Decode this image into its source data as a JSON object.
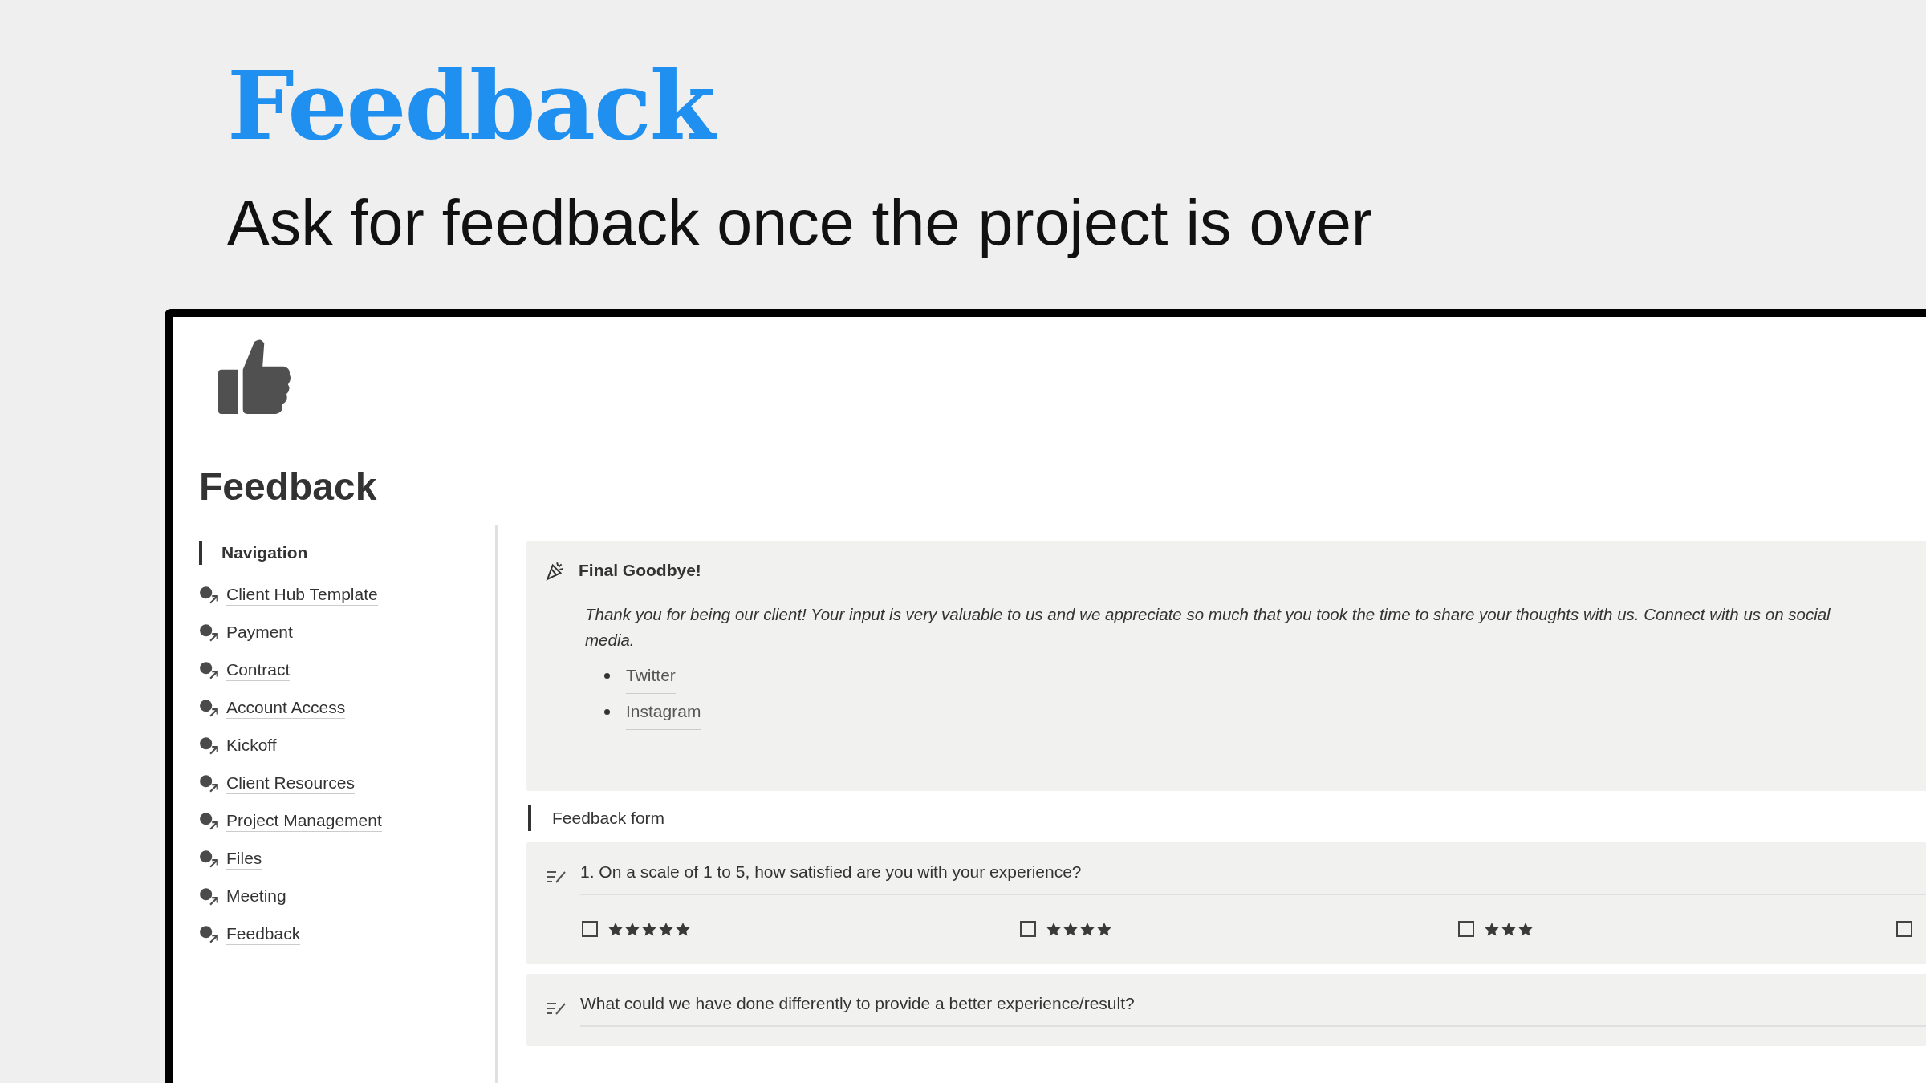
{
  "header": {
    "title": "Feedback",
    "subtitle": "Ask for feedback once the project is over"
  },
  "page": {
    "title": "Feedback"
  },
  "navigation": {
    "heading": "Navigation",
    "items": [
      {
        "label": "Client Hub Template"
      },
      {
        "label": "Payment"
      },
      {
        "label": "Contract"
      },
      {
        "label": "Account Access"
      },
      {
        "label": "Kickoff"
      },
      {
        "label": "Client Resources"
      },
      {
        "label": "Project Management"
      },
      {
        "label": "Files"
      },
      {
        "label": "Meeting"
      },
      {
        "label": "Feedback"
      }
    ]
  },
  "callout": {
    "title": "Final Goodbye!",
    "body": "Thank you for being our client! Your input is very valuable to us and we appreciate so much that you took the time to share your thoughts with us. Connect with us on social media.",
    "links": [
      "Twitter",
      "Instagram"
    ]
  },
  "form": {
    "heading": "Feedback form",
    "questions": [
      {
        "kind": "rating",
        "text": "1. On a scale of 1 to 5, how satisfied are you with your experience?",
        "options": [
          {
            "checked": false,
            "stars": 5
          },
          {
            "checked": false,
            "stars": 4
          },
          {
            "checked": false,
            "stars": 3
          },
          {
            "checked": false
          }
        ]
      },
      {
        "kind": "text",
        "text": "What could we have done differently to provide a better experience/result?"
      }
    ]
  }
}
